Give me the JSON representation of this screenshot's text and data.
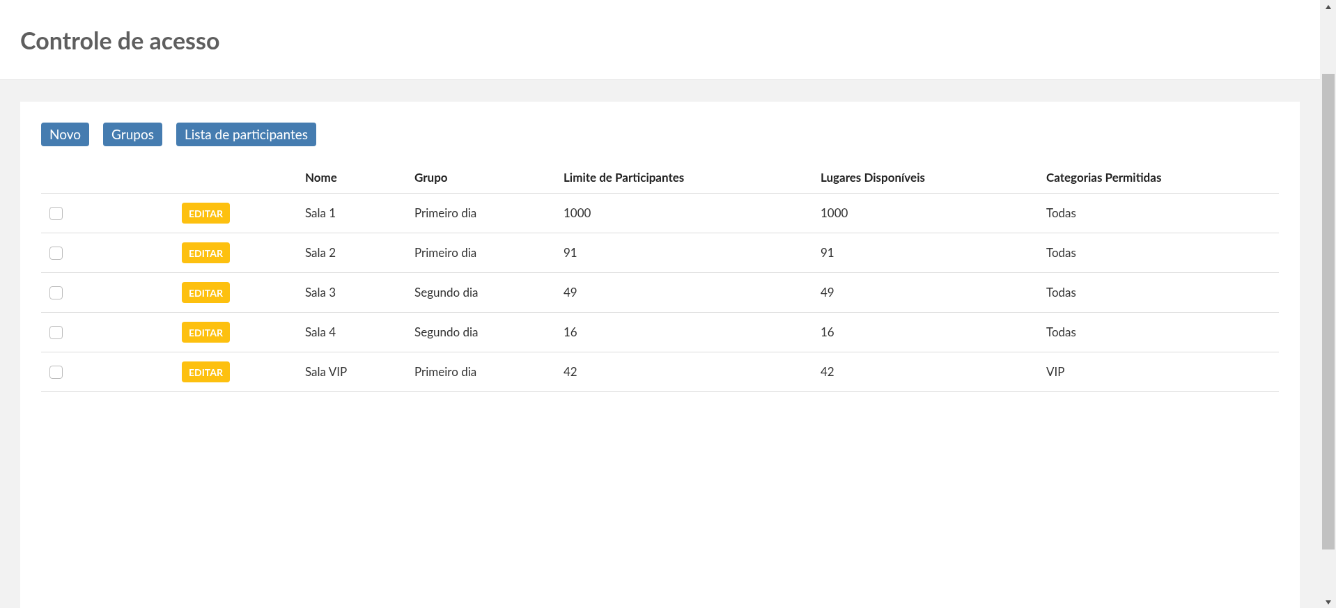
{
  "header": {
    "title": "Controle de acesso"
  },
  "toolbar": {
    "buttons": [
      "Novo",
      "Grupos",
      "Lista de participantes"
    ]
  },
  "table": {
    "columns": [
      "",
      "",
      "Nome",
      "Grupo",
      "Limite de Participantes",
      "Lugares Disponíveis",
      "Categorias Permitidas"
    ],
    "rows": [
      {
        "checked": false,
        "action": "EDITAR",
        "name": "Sala 1",
        "group": "Primeiro dia",
        "limit": "1000",
        "available": "1000",
        "categories": "Todas"
      },
      {
        "checked": false,
        "action": "EDITAR",
        "name": "Sala 2",
        "group": "Primeiro dia",
        "limit": "91",
        "available": "91",
        "categories": "Todas"
      },
      {
        "checked": false,
        "action": "EDITAR",
        "name": "Sala 3",
        "group": "Segundo dia",
        "limit": "49",
        "available": "49",
        "categories": "Todas"
      },
      {
        "checked": false,
        "action": "EDITAR",
        "name": "Sala 4",
        "group": "Segundo dia",
        "limit": "16",
        "available": "16",
        "categories": "Todas"
      },
      {
        "checked": false,
        "action": "EDITAR",
        "name": "Sala VIP",
        "group": "Primeiro dia",
        "limit": "42",
        "available": "42",
        "categories": "VIP"
      }
    ]
  }
}
